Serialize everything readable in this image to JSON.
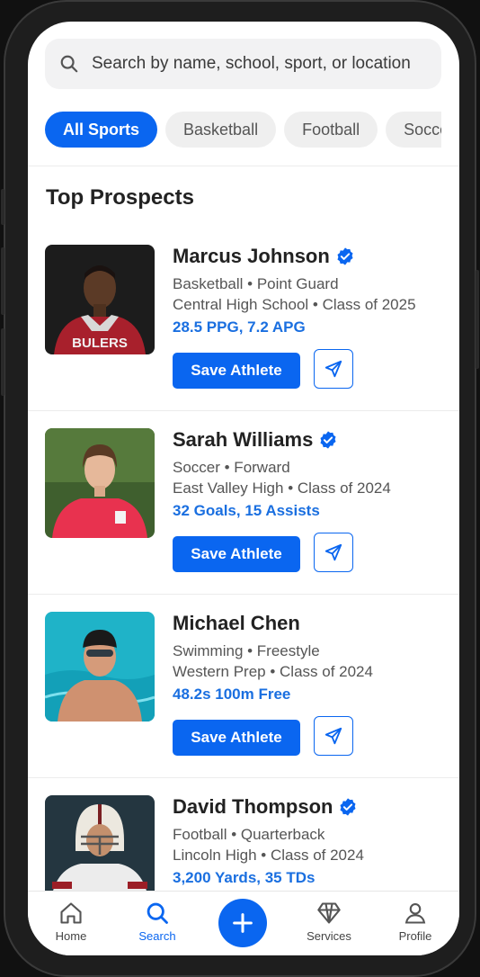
{
  "search": {
    "placeholder": "Search by name, school, sport, or location"
  },
  "filters": [
    "All Sports",
    "Basketball",
    "Football",
    "Soccer"
  ],
  "section_title": "Top Prospects",
  "athletes": [
    {
      "name": "Marcus Johnson",
      "sport_position": "Basketball • Point Guard",
      "school_class": "Central High School • Class of 2025",
      "stats": "28.5 PPG, 7.2 APG",
      "jersey_text": "BULERS"
    },
    {
      "name": "Sarah Williams",
      "sport_position": "Soccer • Forward",
      "school_class": "East Valley High • Class of 2024",
      "stats": "32 Goals, 15 Assists"
    },
    {
      "name": "Michael Chen",
      "sport_position": "Swimming • Freestyle",
      "school_class": "Western Prep • Class of 2024",
      "stats": "48.2s 100m Free"
    },
    {
      "name": "David Thompson",
      "sport_position": "Football • Quarterback",
      "school_class": "Lincoln High • Class of 2024",
      "stats": "3,200 Yards, 35 TDs"
    }
  ],
  "buttons": {
    "save_label": "Save Athlete"
  },
  "nav": {
    "home": "Home",
    "search": "Search",
    "services": "Services",
    "profile": "Profile"
  },
  "colors": {
    "accent": "#0a66f0",
    "stats_text": "#1a6fe0"
  }
}
